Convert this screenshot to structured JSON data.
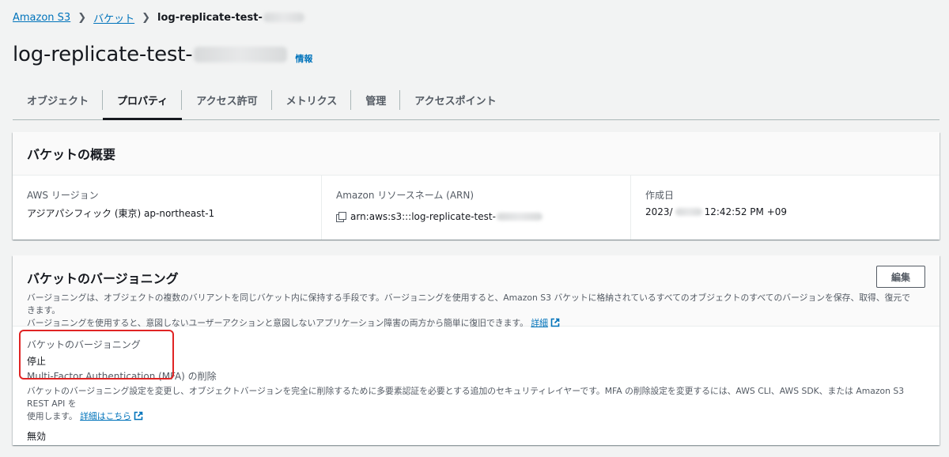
{
  "breadcrumb": {
    "root": "Amazon S3",
    "buckets": "バケット",
    "current": "log-replicate-test-"
  },
  "header": {
    "title": "log-replicate-test-",
    "info": "情報"
  },
  "tabs": [
    {
      "label": "オブジェクト"
    },
    {
      "label": "プロパティ"
    },
    {
      "label": "アクセス許可"
    },
    {
      "label": "メトリクス"
    },
    {
      "label": "管理"
    },
    {
      "label": "アクセスポイント"
    }
  ],
  "overview": {
    "title": "バケットの概要",
    "region_label": "AWS リージョン",
    "region_value": "アジアパシフィック (東京) ap-northeast-1",
    "arn_label": "Amazon リソースネーム (ARN)",
    "arn_value": "arn:aws:s3:::log-replicate-test-",
    "created_label": "作成日",
    "created_prefix": "2023/",
    "created_suffix": "12:42:52 PM +09"
  },
  "versioning": {
    "title": "バケットのバージョニング",
    "edit_label": "編集",
    "description_line1": "バージョニングは、オブジェクトの複数のバリアントを同じバケット内に保持する手段です。バージョニングを使用すると、Amazon S3 バケットに格納されているすべてのオブジェクトのすべてのバージョンを保存、取得、復元できます。",
    "description_line2": "バージョニングを使用すると、意図しないユーザーアクションと意図しないアプリケーション障害の両方から簡単に復旧できます。",
    "learn_more": "詳細",
    "status_label": "バケットのバージョニング",
    "status_value": "停止",
    "mfa_label": "Multi-Factor Authentication (MFA) の削除",
    "mfa_desc_line1": "バケットのバージョニング設定を変更し、オブジェクトバージョンを完全に削除するために多要素認証を必要とする追加のセキュリティレイヤーです。MFA の削除設定を変更するには、AWS CLI、AWS SDK、または Amazon S3 REST API を",
    "mfa_desc_line2": "使用します。",
    "mfa_learn_more": "詳細はこちら",
    "mfa_value": "無効"
  },
  "colors": {
    "link": "#0073bb",
    "highlight": "#e02424"
  }
}
